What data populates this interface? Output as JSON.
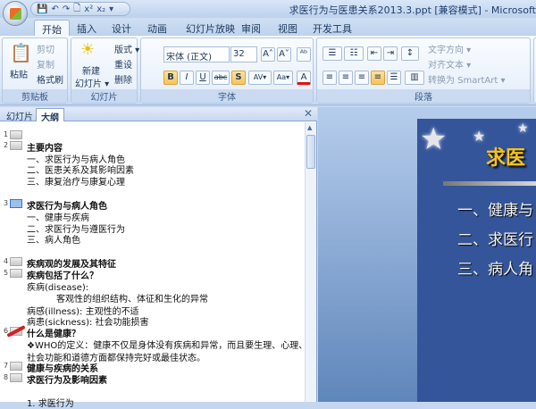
{
  "window": {
    "title": "求医行为与医患关系2013.3.ppt [兼容模式] - Microsoft"
  },
  "qat": {
    "save": "💾",
    "undo": "↶",
    "redo": "↷",
    "preview": "🗋",
    "sup": "x²",
    "sub": "x₂",
    "more": "▾"
  },
  "tabs": [
    "开始",
    "插入",
    "设计",
    "动画",
    "幻灯片放映",
    "审阅",
    "视图",
    "开发工具"
  ],
  "ribbon": {
    "clipboard": {
      "label": "剪贴板",
      "paste": "粘贴",
      "cut": "剪切",
      "copy": "复制",
      "format_painter": "格式刷"
    },
    "slides": {
      "label": "幻灯片",
      "new_slide_1": "新建",
      "new_slide_2": "幻灯片 ▾",
      "layout": "版式 ▾",
      "reset": "重设",
      "delete": "删除"
    },
    "font": {
      "label": "字体",
      "font_name": "宋体 (正文)",
      "font_size": "32",
      "grow": "A˄",
      "shrink": "A˅",
      "clear": "ᴬᵇ",
      "bold": "B",
      "italic": "I",
      "underline": "U",
      "strike": "abc",
      "shadow": "S",
      "spacing": "AV▾",
      "case": "Aa▾",
      "color": "A"
    },
    "paragraph": {
      "label": "段落",
      "text_direction": "文字方向 ▾",
      "align_text": "对齐文本 ▾",
      "smartart": "转换为 SmartArt ▾"
    }
  },
  "outline_pane": {
    "tab_slides": "幻灯片",
    "tab_outline": "大纲",
    "close": "✕",
    "lines": [
      {
        "num": "1",
        "text": "",
        "kind": "t"
      },
      {
        "num": "2",
        "text": "主要内容",
        "kind": "t"
      },
      {
        "text": "一、求医行为与病人角色",
        "kind": "s"
      },
      {
        "text": "二、医患关系及其影响因素",
        "kind": "s"
      },
      {
        "text": "三、康复治疗与康复心理",
        "kind": "s"
      },
      {
        "num": "3",
        "text": "求医行为与病人角色",
        "kind": "t",
        "selected": true
      },
      {
        "text": "一、健康与疾病",
        "kind": "s"
      },
      {
        "text": "二、求医行为与遵医行为",
        "kind": "s"
      },
      {
        "text": "三、病人角色",
        "kind": "s"
      },
      {
        "num": "4",
        "text": "疾病观的发展及其特征",
        "kind": "t"
      },
      {
        "num": "5",
        "text": "疾病包括了什么？",
        "kind": "t"
      },
      {
        "text": "疾病(disease):",
        "kind": "s"
      },
      {
        "text": "客观性的组织结构、体征和生化的异常",
        "kind": "i"
      },
      {
        "text": "病感(illness): 主观性的不适",
        "kind": "s"
      },
      {
        "text": "病患(sickness): 社会功能损害",
        "kind": "s"
      },
      {
        "num": "6",
        "text": "什么是健康？",
        "kind": "t"
      },
      {
        "text": "❖WHO的定义：健康不仅是身体没有疾病和异常，而且要生理、心理、",
        "kind": "s"
      },
      {
        "text": "  社会功能和道德方面都保持完好或最佳状态。",
        "kind": "s"
      },
      {
        "num": "7",
        "text": "健康与疾病的关系",
        "kind": "t"
      },
      {
        "num": "8",
        "text": "求医行为及影响因素",
        "kind": "t"
      },
      {
        "text": "1. 求医行为",
        "kind": "s"
      }
    ]
  },
  "slide": {
    "title": "求医",
    "bullets": [
      "一、健康与",
      "二、求医行",
      "三、病人角"
    ]
  }
}
